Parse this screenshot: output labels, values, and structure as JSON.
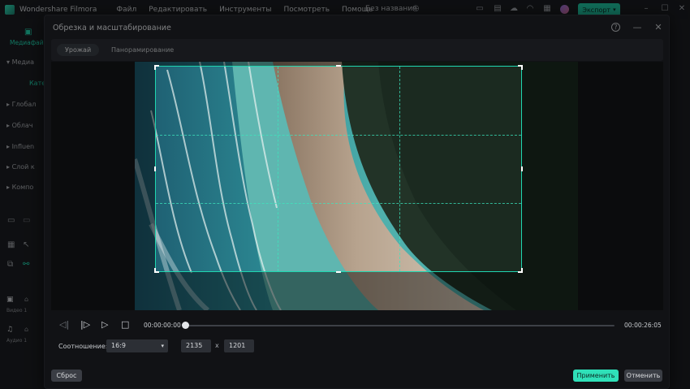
{
  "app": {
    "name": "Wondershare Filmora",
    "menu": [
      "Файл",
      "Редактировать",
      "Инструменты",
      "Посмотреть",
      "Помощь"
    ],
    "project_title": "Без названия",
    "export_label": "Экспорт",
    "accent_color": "#1fc4a0"
  },
  "left_panel": {
    "tab_label": "Медиафай",
    "tree": [
      "Медиа",
      "Кате",
      "Глобал",
      "Облач",
      "Influen",
      "Слой к",
      "Компо"
    ],
    "tracks": [
      "Видео 1",
      "Аудио 1"
    ]
  },
  "dialog": {
    "title": "Обрезка и масштабирование",
    "help_icon": "help-icon",
    "minimize_icon": "minimize-icon",
    "close_icon": "close-icon",
    "tabs": [
      {
        "label": "Урожай",
        "active": true
      },
      {
        "label": "Панорамирование",
        "active": false
      }
    ],
    "playback": {
      "current_time": "00:00:00:00",
      "total_time": "00:00:26:05",
      "progress": 0.0
    },
    "ratio": {
      "label": "Соотношение:",
      "selected": "16:9",
      "width": "2135",
      "separator": "x",
      "height": "1201"
    },
    "buttons": {
      "reset": "Сброс",
      "apply": "Применить",
      "cancel": "Отменить"
    }
  }
}
